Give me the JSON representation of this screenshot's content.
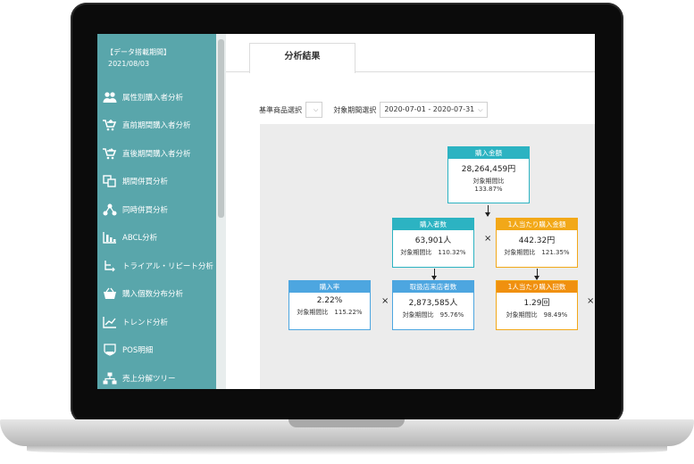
{
  "sidebar": {
    "date_label": "【データ搭載期間】",
    "date_value": "2021/08/03",
    "items": [
      {
        "label": "属性別購入者分析",
        "icon": "people-icon"
      },
      {
        "label": "直前期間購入者分析",
        "icon": "cart-plus-icon"
      },
      {
        "label": "直後期間購入者分析",
        "icon": "cart-arrow-icon"
      },
      {
        "label": "期間併買分析",
        "icon": "period-basket-icon"
      },
      {
        "label": "同時併買分析",
        "icon": "share-nodes-icon"
      },
      {
        "label": "ABCL分析",
        "icon": "abc-chart-icon"
      },
      {
        "label": "トライアル・リピート分析",
        "icon": "repeat-flow-icon"
      },
      {
        "label": "購入個数分布分析",
        "icon": "basket-icon"
      },
      {
        "label": "トレンド分析",
        "icon": "trend-icon"
      },
      {
        "label": "POS明細",
        "icon": "pos-shield-icon"
      },
      {
        "label": "売上分解ツリー",
        "icon": "tree-icon"
      }
    ]
  },
  "tab": {
    "label": "分析結果"
  },
  "filters": {
    "product_label": "基準商品選択",
    "product_value": "",
    "period_label": "対象期間選択",
    "period_value": "2020-07-01 - 2020-07-31"
  },
  "tree": {
    "total": {
      "title": "購入金額",
      "value": "28,264,459円",
      "cmp_label": "対象期間比",
      "cmp_value": "133.87%"
    },
    "buyers": {
      "title": "購入者数",
      "value": "63,901人",
      "cmp": "対象期間比　110.32%"
    },
    "per_buyer": {
      "title": "1人当たり購入金額",
      "value": "442.32円",
      "cmp": "対象期間比　121.35%"
    },
    "rate": {
      "title": "購入率",
      "value": "2.22%",
      "cmp": "対象期間比　115.22%"
    },
    "visitors": {
      "title": "取扱店来店者数",
      "value": "2,873,585人",
      "cmp": "対象期間比　95.76%"
    },
    "frequency": {
      "title": "1人当たり購入回数",
      "value": "1.29回",
      "cmp": "対象期間比　98.49%"
    },
    "multiply": "×"
  },
  "colors": {
    "sidebar": "#59a6ab",
    "teal": "#2cb3c2",
    "orange": "#f2a818",
    "sky": "#4da6e0"
  }
}
